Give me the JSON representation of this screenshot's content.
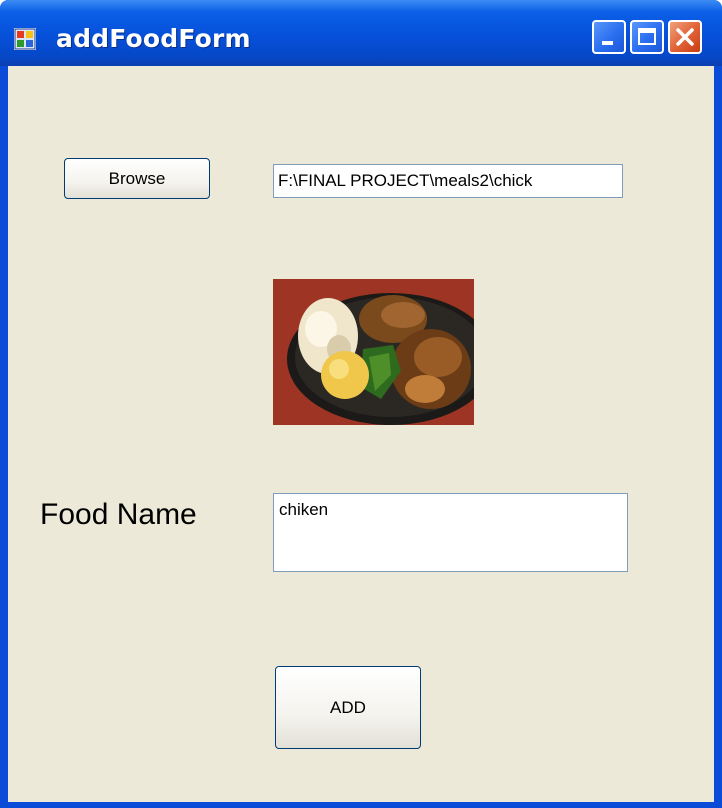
{
  "window": {
    "title": "addFoodForm",
    "icon": "form-app-icon",
    "controls": [
      "minimize-icon",
      "maximize-icon",
      "close-icon"
    ]
  },
  "form": {
    "browse_label": "Browse",
    "path_value": "F:\\FINAL PROJECT\\meals2\\chick",
    "picture": "chicken-meal-photo",
    "food_name_label": "Food Name",
    "food_name_value": "chiken",
    "add_label": "ADD"
  },
  "colors": {
    "titlebar": "#0650d9",
    "client_bg": "#ece9d8",
    "close_button": "#e2643a",
    "textbox_border": "#7f9db9",
    "button_border": "#003c74"
  }
}
